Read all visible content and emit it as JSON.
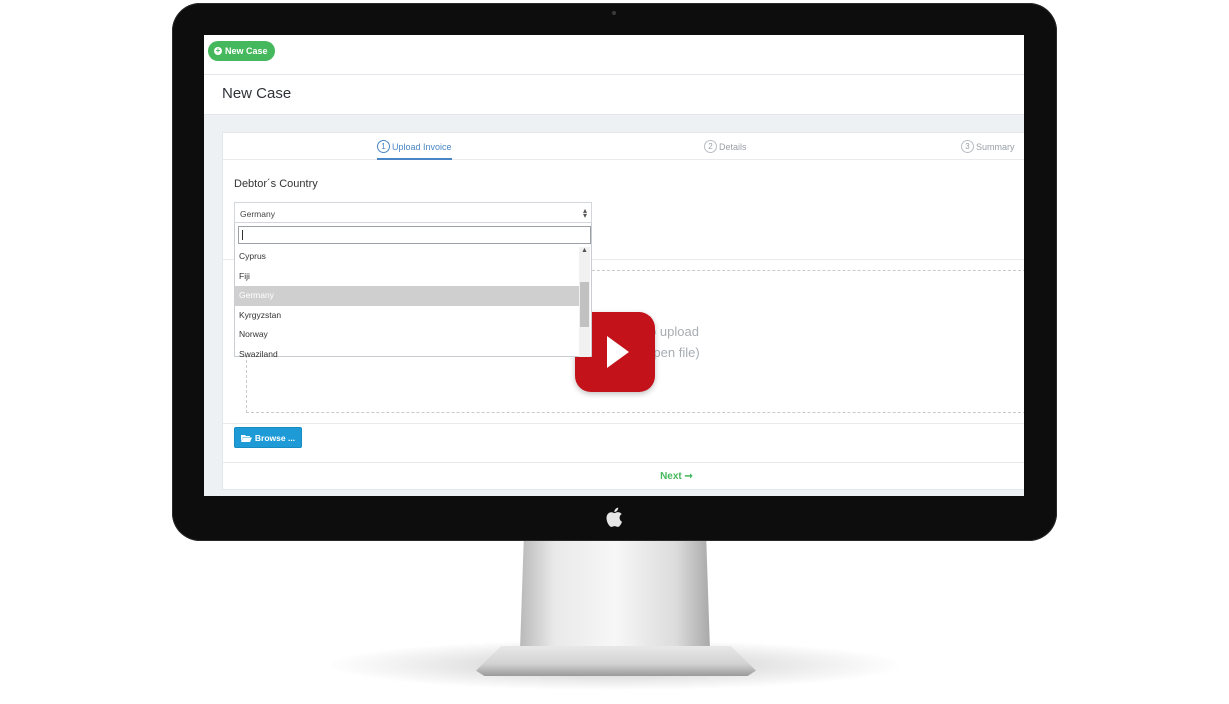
{
  "toolbar": {
    "new_case_label": "New Case"
  },
  "page": {
    "title": "New Case"
  },
  "steps": [
    {
      "number": "1",
      "label": "Upload Invoice",
      "active": true
    },
    {
      "number": "2",
      "label": "Details",
      "active": false
    },
    {
      "number": "3",
      "label": "Summary",
      "active": false
    }
  ],
  "form": {
    "country_label": "Debtor´s Country",
    "country_selected": "Germany",
    "search_value": "",
    "country_options": [
      "Cyprus",
      "Fiji",
      "Germany",
      "Kyrgyzstan",
      "Norway",
      "Swaziland"
    ]
  },
  "upload": {
    "dropzone_line1": "Drop PDF to upload",
    "dropzone_line2": "(or click to open file)",
    "browse_label": "Browse ..."
  },
  "footer": {
    "next_label": "Next"
  },
  "colors": {
    "accent_green": "#45b85d",
    "step_blue": "#4a86c5",
    "browse_blue": "#1e9bd7",
    "play_red": "#c4121a"
  }
}
